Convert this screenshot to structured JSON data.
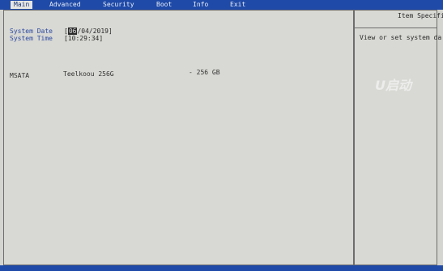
{
  "menu": {
    "tabs": [
      {
        "label": "Main",
        "active": true
      },
      {
        "label": "Advanced",
        "active": false
      },
      {
        "label": "Security",
        "active": false
      },
      {
        "label": "Boot",
        "active": false
      },
      {
        "label": "Info",
        "active": false
      },
      {
        "label": "Exit",
        "active": false
      }
    ]
  },
  "main": {
    "system_date_label": "System Date",
    "system_date_selected": "06",
    "system_date_rest": "/04/2019]",
    "system_date_open": "[",
    "system_time_label": "System Time",
    "system_time_value": "[10:29:34]",
    "msata_label": "MSATA",
    "msata_model": "Teelkoou 256G",
    "msata_size": "- 256 GB"
  },
  "help": {
    "title": "Item Specific",
    "text": "View or set system da"
  },
  "watermark": {
    "text": "U启动"
  },
  "colors": {
    "menubar": "#1f4aa8",
    "label": "#2c4aa0",
    "background": "#d8d8d4"
  }
}
